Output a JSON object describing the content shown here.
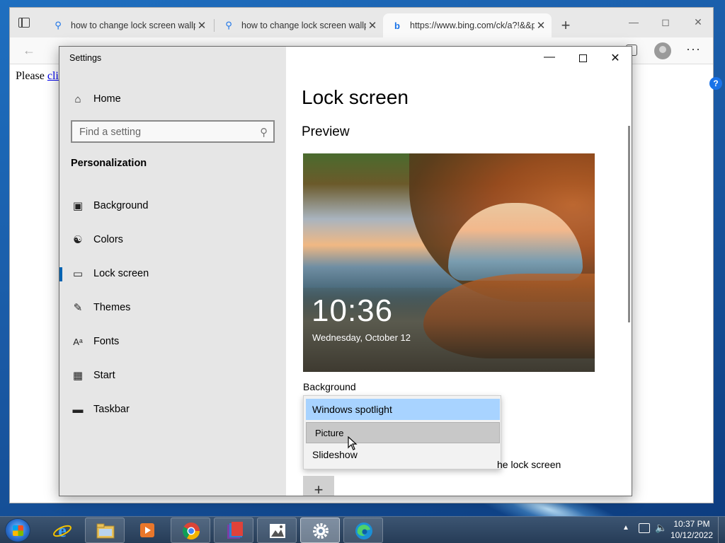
{
  "browser": {
    "tabs": [
      {
        "title": "how to change lock screen wallpaper",
        "icon": "search-icon"
      },
      {
        "title": "how to change lock screen wallpaper",
        "icon": "search-icon"
      },
      {
        "title": "https://www.bing.com/ck/a?!&&p=",
        "icon": "bing-icon"
      }
    ],
    "active_tab": 2,
    "page_text_prefix": "Please ",
    "page_link": "cli"
  },
  "settings": {
    "window_title": "Settings",
    "home_label": "Home",
    "search_placeholder": "Find a setting",
    "section": "Personalization",
    "nav_items": [
      {
        "label": "Background",
        "icon": "picture-icon"
      },
      {
        "label": "Colors",
        "icon": "palette-icon"
      },
      {
        "label": "Lock screen",
        "icon": "lock-screen-icon",
        "selected": true
      },
      {
        "label": "Themes",
        "icon": "themes-icon"
      },
      {
        "label": "Fonts",
        "icon": "fonts-icon"
      },
      {
        "label": "Start",
        "icon": "start-icon"
      },
      {
        "label": "Taskbar",
        "icon": "taskbar-icon"
      }
    ],
    "page_title": "Lock screen",
    "preview_heading": "Preview",
    "preview_time": "10:36",
    "preview_date": "Wednesday, October 12",
    "background_label": "Background",
    "dropdown_options": [
      {
        "label": "Windows spotlight",
        "state": "selected"
      },
      {
        "label": "Picture",
        "state": "hover"
      },
      {
        "label": "Slideshow",
        "state": "normal"
      }
    ],
    "partial_text": "he lock screen",
    "add_button": "+"
  },
  "taskbar": {
    "pinned": [
      "internet-explorer",
      "file-explorer",
      "media-player",
      "chrome",
      "winrar",
      "photos",
      "settings",
      "edge"
    ],
    "time": "10:37 PM",
    "date": "10/12/2022"
  },
  "colors": {
    "accent": "#0063b1",
    "dropdown_selected": "#a8d3ff",
    "nav_background": "#e6e6e6"
  }
}
